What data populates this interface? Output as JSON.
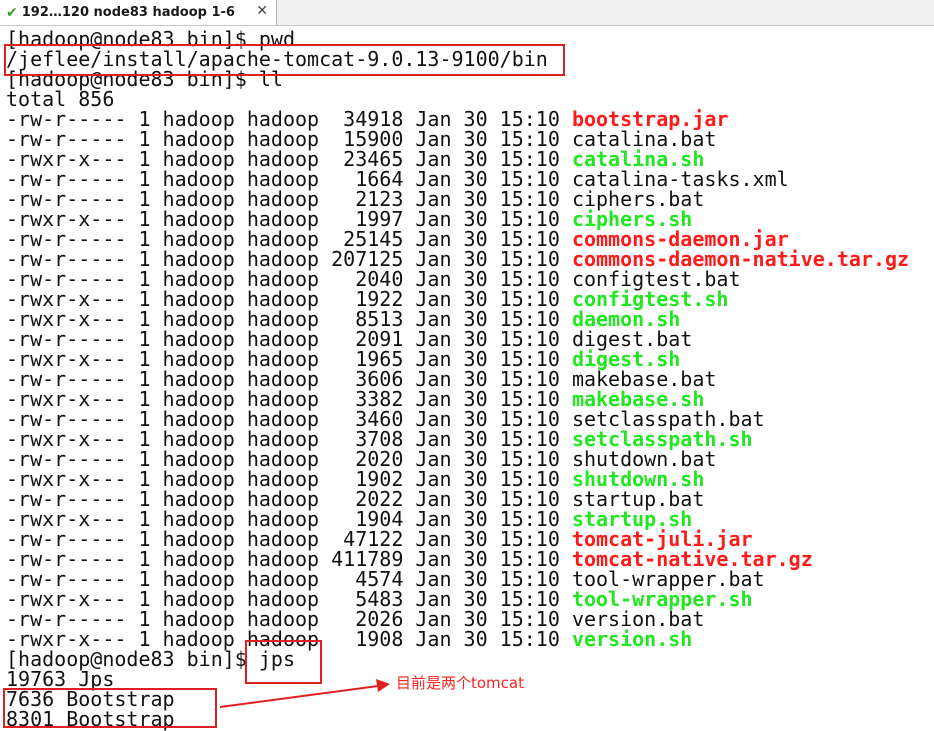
{
  "tab": {
    "title": "192…120 node83 hadoop 1-6",
    "icon": "check-icon",
    "close_icon": "close-icon"
  },
  "lines": [
    {
      "text": "[hadoop@node83 bin]$ pwd"
    },
    {
      "text": "/jeflee/install/apache-tomcat-9.0.13-9100/bin"
    },
    {
      "text": "[hadoop@node83 bin]$ ll"
    },
    {
      "text": "total 856"
    },
    {
      "prefix": "-rw-r----- 1 hadoop hadoop  34918 Jan 30 15:10 ",
      "name": "bootstrap.jar",
      "style": "red"
    },
    {
      "prefix": "-rw-r----- 1 hadoop hadoop  15900 Jan 30 15:10 ",
      "name": "catalina.bat",
      "style": "plain"
    },
    {
      "prefix": "-rwxr-x--- 1 hadoop hadoop  23465 Jan 30 15:10 ",
      "name": "catalina.sh",
      "style": "green"
    },
    {
      "prefix": "-rw-r----- 1 hadoop hadoop   1664 Jan 30 15:10 ",
      "name": "catalina-tasks.xml",
      "style": "plain"
    },
    {
      "prefix": "-rw-r----- 1 hadoop hadoop   2123 Jan 30 15:10 ",
      "name": "ciphers.bat",
      "style": "plain"
    },
    {
      "prefix": "-rwxr-x--- 1 hadoop hadoop   1997 Jan 30 15:10 ",
      "name": "ciphers.sh",
      "style": "green"
    },
    {
      "prefix": "-rw-r----- 1 hadoop hadoop  25145 Jan 30 15:10 ",
      "name": "commons-daemon.jar",
      "style": "red"
    },
    {
      "prefix": "-rw-r----- 1 hadoop hadoop 207125 Jan 30 15:10 ",
      "name": "commons-daemon-native.tar.gz",
      "style": "red"
    },
    {
      "prefix": "-rw-r----- 1 hadoop hadoop   2040 Jan 30 15:10 ",
      "name": "configtest.bat",
      "style": "plain"
    },
    {
      "prefix": "-rwxr-x--- 1 hadoop hadoop   1922 Jan 30 15:10 ",
      "name": "configtest.sh",
      "style": "green"
    },
    {
      "prefix": "-rwxr-x--- 1 hadoop hadoop   8513 Jan 30 15:10 ",
      "name": "daemon.sh",
      "style": "green"
    },
    {
      "prefix": "-rw-r----- 1 hadoop hadoop   2091 Jan 30 15:10 ",
      "name": "digest.bat",
      "style": "plain"
    },
    {
      "prefix": "-rwxr-x--- 1 hadoop hadoop   1965 Jan 30 15:10 ",
      "name": "digest.sh",
      "style": "green"
    },
    {
      "prefix": "-rw-r----- 1 hadoop hadoop   3606 Jan 30 15:10 ",
      "name": "makebase.bat",
      "style": "plain"
    },
    {
      "prefix": "-rwxr-x--- 1 hadoop hadoop   3382 Jan 30 15:10 ",
      "name": "makebase.sh",
      "style": "green"
    },
    {
      "prefix": "-rw-r----- 1 hadoop hadoop   3460 Jan 30 15:10 ",
      "name": "setclasspath.bat",
      "style": "plain"
    },
    {
      "prefix": "-rwxr-x--- 1 hadoop hadoop   3708 Jan 30 15:10 ",
      "name": "setclasspath.sh",
      "style": "green"
    },
    {
      "prefix": "-rw-r----- 1 hadoop hadoop   2020 Jan 30 15:10 ",
      "name": "shutdown.bat",
      "style": "plain"
    },
    {
      "prefix": "-rwxr-x--- 1 hadoop hadoop   1902 Jan 30 15:10 ",
      "name": "shutdown.sh",
      "style": "green"
    },
    {
      "prefix": "-rw-r----- 1 hadoop hadoop   2022 Jan 30 15:10 ",
      "name": "startup.bat",
      "style": "plain"
    },
    {
      "prefix": "-rwxr-x--- 1 hadoop hadoop   1904 Jan 30 15:10 ",
      "name": "startup.sh",
      "style": "green"
    },
    {
      "prefix": "-rw-r----- 1 hadoop hadoop  47122 Jan 30 15:10 ",
      "name": "tomcat-juli.jar",
      "style": "red"
    },
    {
      "prefix": "-rw-r----- 1 hadoop hadoop 411789 Jan 30 15:10 ",
      "name": "tomcat-native.tar.gz",
      "style": "red"
    },
    {
      "prefix": "-rw-r----- 1 hadoop hadoop   4574 Jan 30 15:10 ",
      "name": "tool-wrapper.bat",
      "style": "plain"
    },
    {
      "prefix": "-rwxr-x--- 1 hadoop hadoop   5483 Jan 30 15:10 ",
      "name": "tool-wrapper.sh",
      "style": "green"
    },
    {
      "prefix": "-rw-r----- 1 hadoop hadoop   2026 Jan 30 15:10 ",
      "name": "version.bat",
      "style": "plain"
    },
    {
      "prefix": "-rwxr-x--- 1 hadoop hadoop   1908 Jan 30 15:10 ",
      "name": "version.sh",
      "style": "green"
    },
    {
      "text": "[hadoop@node83 bin]$ jps"
    },
    {
      "text": "19763 Jps"
    },
    {
      "text": "7636 Bootstrap"
    },
    {
      "text": "8301 Bootstrap"
    }
  ],
  "annotation": {
    "text": "目前是两个tomcat",
    "color": "#ff2020"
  },
  "colors": {
    "red": "#ff1a1a",
    "green": "#22e622",
    "box": "#e02020",
    "text": "#111111"
  }
}
